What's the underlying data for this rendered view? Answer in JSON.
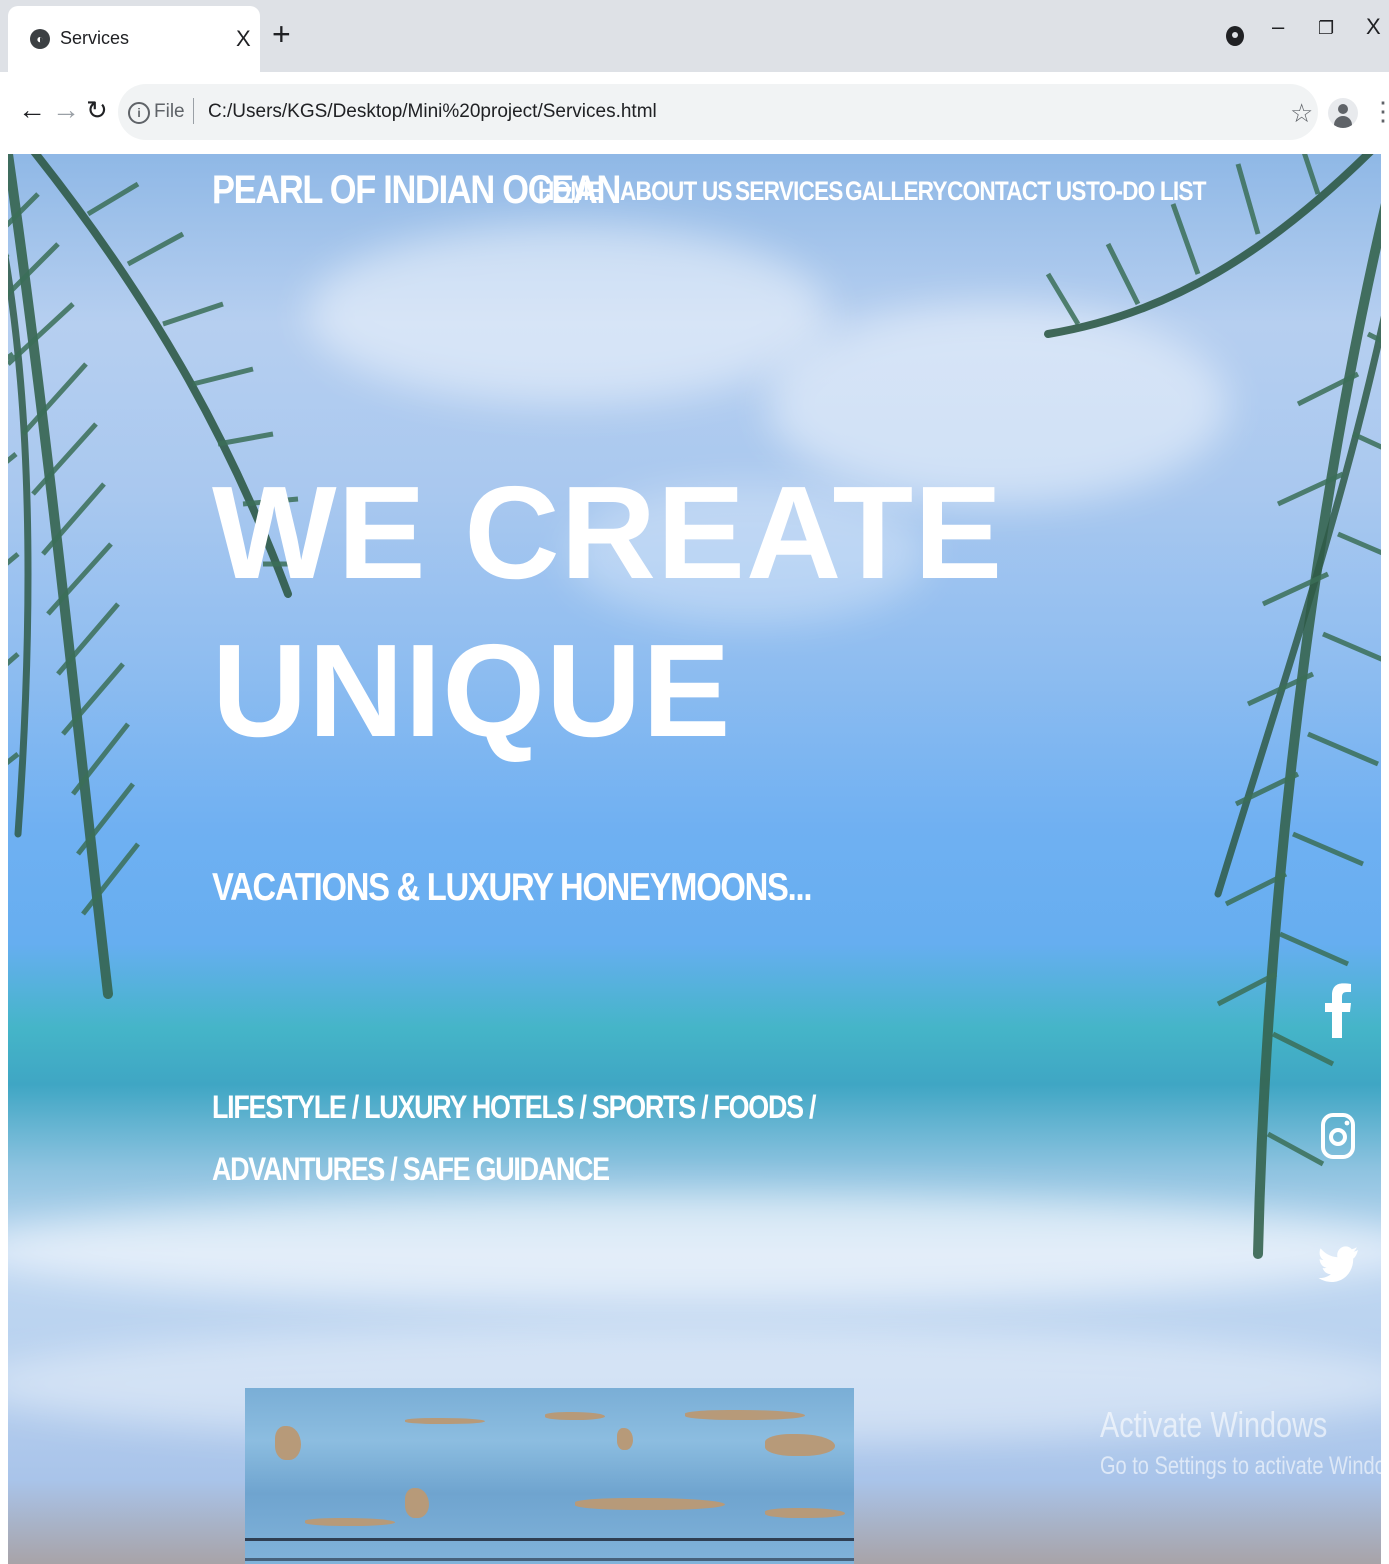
{
  "browser": {
    "tab_title": "Services",
    "tab_close": "X",
    "new_tab": "+",
    "window_minimize": "–",
    "window_maximize": "❐",
    "window_close": "X",
    "address_scheme": "File",
    "address_url": "C:/Users/KGS/Desktop/Mini%20project/Services.html"
  },
  "site": {
    "brand": "PEARL OF INDIAN OCEAN",
    "nav": [
      "HOME",
      "ABOUT US",
      "SERVICES",
      "GALLERY",
      "CONTACT US",
      "TO-DO LIST"
    ],
    "hero_title_line1": "WE CREATE",
    "hero_title_line2": "UNIQUE",
    "hero_subtitle": "VACATIONS & LUXURY HONEYMOONS...",
    "hero_services": "LIFESTYLE / LUXURY HOTELS / SPORTS / FOODS / ADVANTURES / SAFE GUIDANCE",
    "social_icons": [
      "facebook-icon",
      "instagram-icon",
      "twitter-icon"
    ]
  },
  "os_watermark": {
    "title": "Activate Windows",
    "text": "Go to Settings to activate Windows."
  },
  "colors": {
    "text": "#ffffff",
    "tab_strip": "#dee1e6",
    "omnibox": "#f1f3f4"
  }
}
